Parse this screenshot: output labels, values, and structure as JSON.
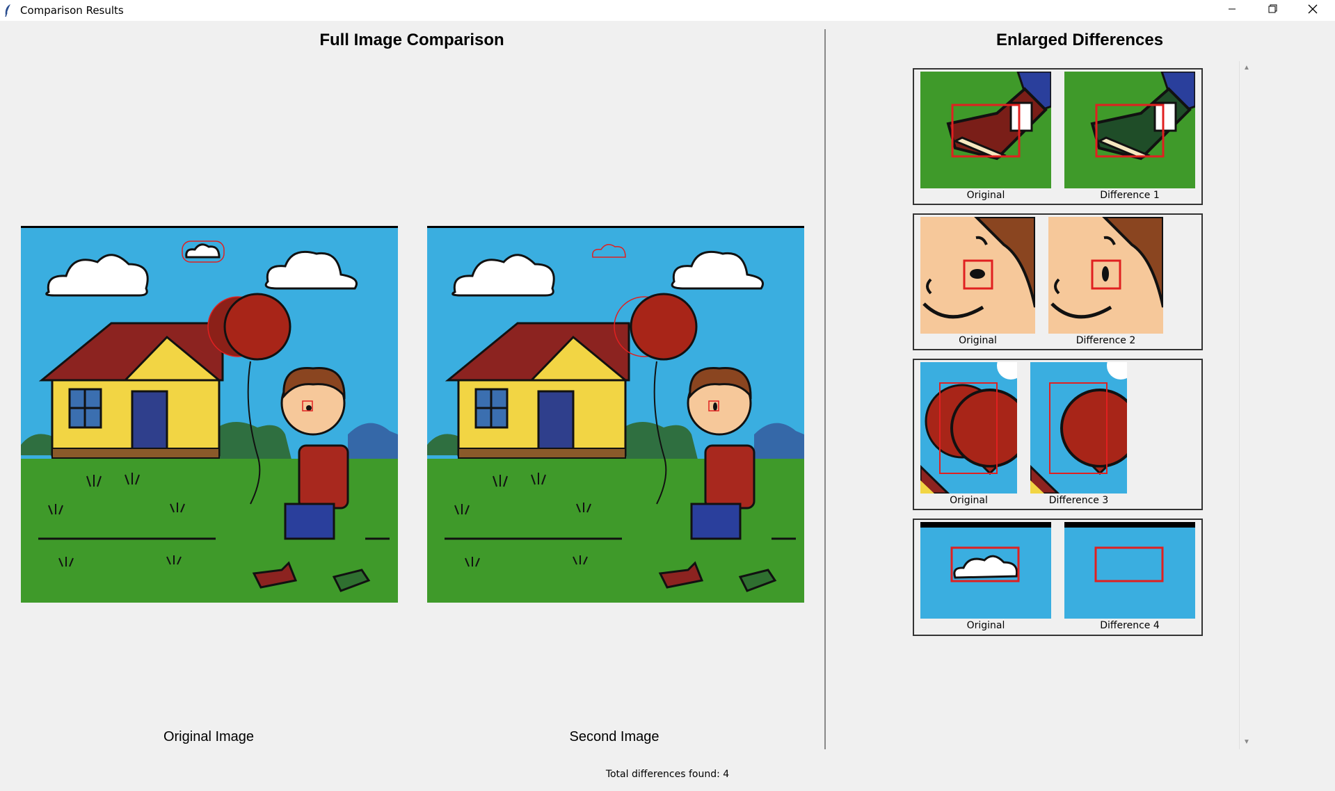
{
  "window": {
    "title": "Comparison Results",
    "minimize_icon": "minimize-icon",
    "restore_icon": "restore-icon",
    "close_icon": "close-icon"
  },
  "left_panel": {
    "title": "Full Image Comparison",
    "original_caption": "Original Image",
    "second_caption": "Second Image"
  },
  "right_panel": {
    "title": "Enlarged Differences",
    "cards": [
      {
        "left_label": "Original",
        "right_label": "Difference 1"
      },
      {
        "left_label": "Original",
        "right_label": "Difference 2"
      },
      {
        "left_label": "Original",
        "right_label": "Difference 3"
      },
      {
        "left_label": "Original",
        "right_label": "Difference 4"
      }
    ],
    "scroll_up_icon": "scroll-up-icon",
    "scroll_down_icon": "scroll-down-icon"
  },
  "status": {
    "total_text": "Total differences found: 4",
    "count": 4
  },
  "colors": {
    "sky": "#3aaee0",
    "grass": "#3f9a2a",
    "house_wall": "#f2d544",
    "roof": "#8c2320",
    "door": "#2f3f8c",
    "balloon": "#a82518",
    "highlight": "#e02020"
  }
}
